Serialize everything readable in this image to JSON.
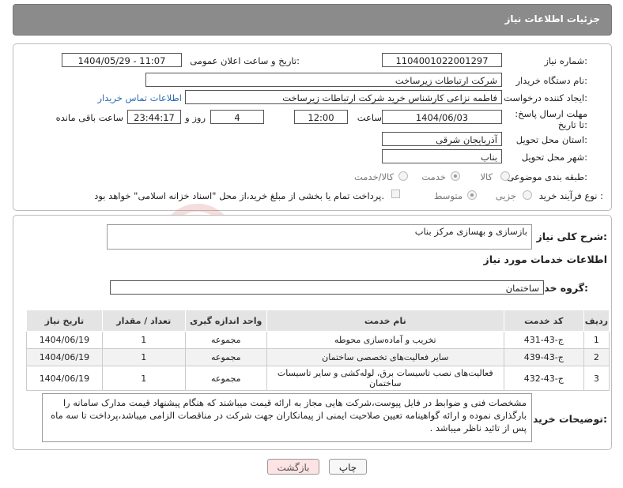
{
  "header": {
    "title": "جزئیات اطلاعات نیاز"
  },
  "form": {
    "need_number_label": "شماره نیاز:",
    "need_number": "1104001022001297",
    "announce_label": "تاریخ و ساعت اعلان عمومی:",
    "announce_value": "1404/05/29 - 11:07",
    "buyer_org_label": "نام دستگاه خریدار:",
    "buyer_org": "شرکت ارتباطات زیرساخت",
    "creator_label": "ایجاد کننده درخواست:",
    "creator": "فاطمه نزاعی کارشناس خرید شرکت ارتباطات زیرساخت",
    "contact_link": "اطلاعات تماس خریدار",
    "deadline_label": "مهلت ارسال پاسخ: تا تاریخ:",
    "deadline_date": "1404/06/03",
    "time_label": "ساعت",
    "deadline_time": "12:00",
    "days_value": "4",
    "days_label": "روز و",
    "remaining_time": "23:44:17",
    "remaining_label": "ساعت باقی مانده",
    "province_label": "استان محل تحویل:",
    "province": "آذربایجان شرقی",
    "city_label": "شهر محل تحویل:",
    "city": "بناب",
    "category_label": "طبقه بندی موضوعی:",
    "category_options": [
      "کالا",
      "خدمت",
      "کالا/خدمت"
    ],
    "category_selected": "خدمت",
    "process_label": "نوع فرآیند خرید :",
    "process_options": [
      "جزیی",
      "متوسط"
    ],
    "process_selected": "متوسط",
    "payment_note": "پرداخت تمام یا بخشی از مبلغ خرید،از محل \"اسناد خزانه اسلامی\" خواهد بود."
  },
  "needs": {
    "summary_label": "شرح کلی نیاز:",
    "summary": "بازسازی و بهسازی مرکز بناب",
    "services_title": "اطلاعات خدمات مورد نیاز",
    "group_label": "گروه خدمت:",
    "group": "ساختمان",
    "table": {
      "headers": [
        "ردیف",
        "کد خدمت",
        "نام خدمت",
        "واحد اندازه گیری",
        "تعداد / مقدار",
        "تاریخ نیاز"
      ],
      "rows": [
        [
          "1",
          "ج-43-431",
          "تخریب و آماده‌سازی محوطه",
          "مجموعه",
          "1",
          "1404/06/19"
        ],
        [
          "2",
          "ج-43-439",
          "سایر فعالیت‌های تخصصی ساختمان",
          "مجموعه",
          "1",
          "1404/06/19"
        ],
        [
          "3",
          "ج-43-432",
          "فعالیت‌های نصب تاسیسات برق، لوله‌کشی و سایر تاسیسات ساختمان",
          "مجموعه",
          "1",
          "1404/06/19"
        ]
      ]
    },
    "buyer_notes_label": "توضیحات خریدار:",
    "buyer_notes": "مشخصات فنی و ضوابط در فایل پیوست،شرکت هایی مجاز به ارائه قیمت میباشند که هنگام پیشنهاد قیمت مدارک سامانه را بارگذاری نمودە و ارائه گواهینامه تعیین صلاحیت ایمنی از پیمانکاران جهت شرکت در مناقصات الزامی میباشد،پرداخت تا سه ماه پس از تائید ناظر میباشد ."
  },
  "buttons": {
    "print": "چاپ",
    "back": "بازگشت"
  },
  "colors": {
    "header_bg": "#8b8b8b",
    "back_btn_bg": "#fde3e3",
    "link": "#2b6cb0"
  }
}
